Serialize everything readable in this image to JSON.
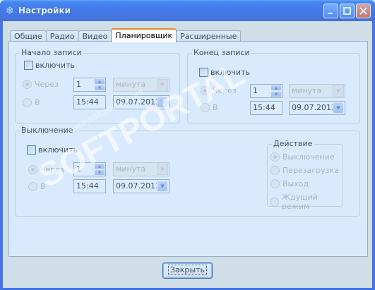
{
  "window": {
    "title": "Настройки",
    "icon": "snowflake-icon"
  },
  "tabs": [
    {
      "label": "Общие"
    },
    {
      "label": "Радио"
    },
    {
      "label": "Видео"
    },
    {
      "label": "Планировщик",
      "active": true
    },
    {
      "label": "Расширенные"
    }
  ],
  "start": {
    "group_label": "Начало записи",
    "enable_label": "включить",
    "through_label": "Через",
    "at_label": "В",
    "count": "1",
    "unit": "минута",
    "time": "15:44",
    "date": "09.07.2013"
  },
  "end": {
    "group_label": "Конец записи",
    "enable_label": "включить",
    "through_label": "Через",
    "at_label": "В",
    "count": "1",
    "unit": "минута",
    "time": "15:44",
    "date": "09.07.2013"
  },
  "shutdown": {
    "group_label": "Выключение",
    "enable_label": "включить",
    "through_label": "Через",
    "at_label": "В",
    "count": "1",
    "unit": "минута",
    "time": "15:44",
    "date": "09.07.2013"
  },
  "action": {
    "group_label": "Действие",
    "options": [
      "Выключение",
      "Перезагрузка",
      "Выход",
      "Ждущий режим"
    ]
  },
  "close_button": "Закрыть",
  "watermark": {
    "brand": "SOFTPORTAL",
    "url": "www.softportal.com",
    "tm": "TM"
  },
  "colors": {
    "titlebar": "#0a48d8",
    "tab_highlight": "#e68b2c",
    "overlay": "#a4ceff"
  }
}
